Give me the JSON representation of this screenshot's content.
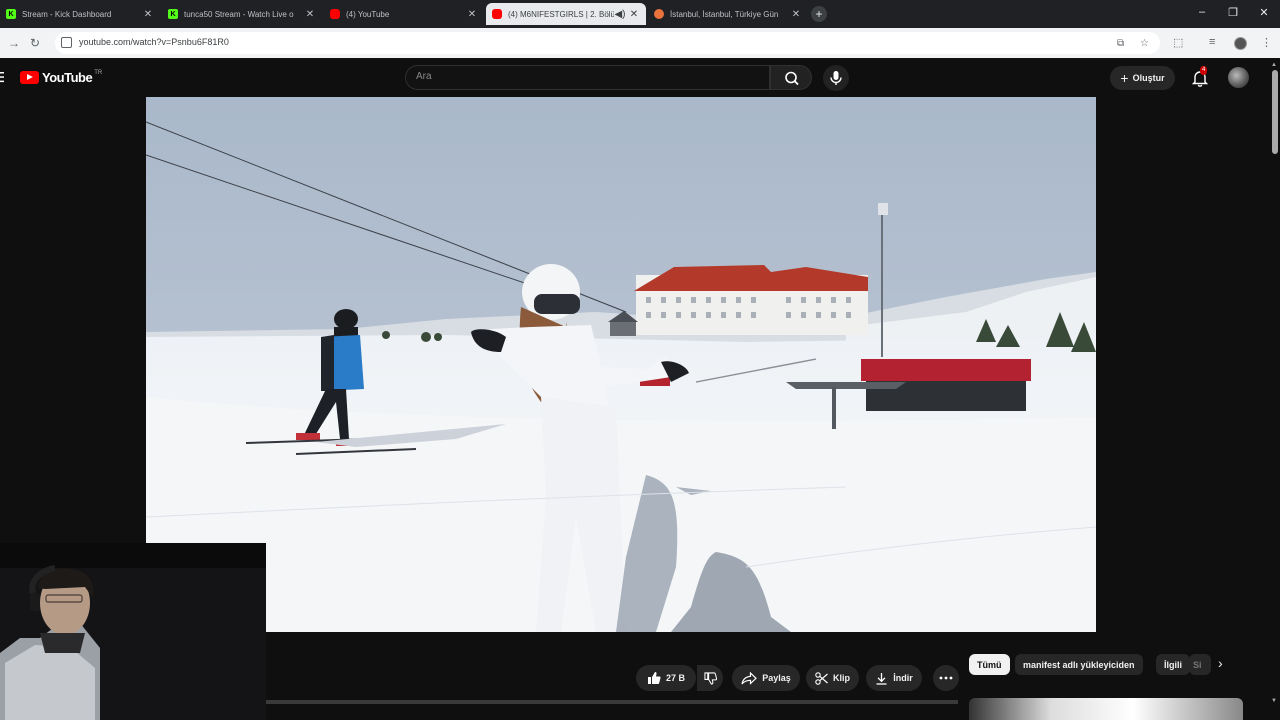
{
  "browser": {
    "tabs": [
      {
        "title": "Stream - Kick Dashboard",
        "favicon": "kick-icon",
        "favicon_color": "#53fc18",
        "active": false
      },
      {
        "title": "tunca50 Stream - Watch Live o",
        "favicon": "kick-icon",
        "favicon_color": "#53fc18",
        "active": false
      },
      {
        "title": "(4) YouTube",
        "favicon": "youtube-icon",
        "favicon_color": "#ff0000",
        "active": false
      },
      {
        "title": "(4) M6NIFESTGIRLS | 2. Bölü",
        "favicon": "youtube-icon",
        "favicon_color": "#ff0000",
        "active": true
      },
      {
        "title": "İstanbul, İstanbul, Türkiye Gün",
        "favicon": "weather-icon",
        "favicon_color": "#e8713c",
        "active": false
      }
    ],
    "url": "youtube.com/watch?v=Psnbu6F81R0"
  },
  "youtube": {
    "logo_text": "YouTube",
    "country_code": "TR",
    "search_placeholder": "Ara",
    "create_label": "Oluştur",
    "notification_count": "4",
    "accent_color": "#ff0000"
  },
  "video_actions": {
    "like_count": "27 B",
    "share_label": "Paylaş",
    "clip_label": "Klip",
    "download_label": "İndir"
  },
  "chips": [
    {
      "label": "Tümü",
      "selected": true
    },
    {
      "label": "manifest adlı yükleyiciden",
      "selected": false
    },
    {
      "label": "İlgili",
      "selected": false
    },
    {
      "label": "Si",
      "selected": false
    }
  ]
}
